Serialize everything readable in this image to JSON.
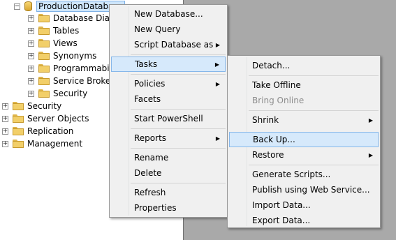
{
  "tree": {
    "root": {
      "label": "ProductionDatabase"
    },
    "children": [
      {
        "label": "Database Diagrams"
      },
      {
        "label": "Tables"
      },
      {
        "label": "Views"
      },
      {
        "label": "Synonyms"
      },
      {
        "label": "Programmability"
      },
      {
        "label": "Service Broker"
      },
      {
        "label": "Security"
      }
    ],
    "top_level": [
      {
        "label": "Security"
      },
      {
        "label": "Server Objects"
      },
      {
        "label": "Replication"
      },
      {
        "label": "Management"
      }
    ]
  },
  "context_menu": {
    "items": [
      {
        "label": "New Database..."
      },
      {
        "label": "New Query"
      },
      {
        "label": "Script Database as"
      },
      {
        "label": "Tasks"
      },
      {
        "label": "Policies"
      },
      {
        "label": "Facets"
      },
      {
        "label": "Start PowerShell"
      },
      {
        "label": "Reports"
      },
      {
        "label": "Rename"
      },
      {
        "label": "Delete"
      },
      {
        "label": "Refresh"
      },
      {
        "label": "Properties"
      }
    ]
  },
  "tasks_menu": {
    "items": [
      {
        "label": "Detach..."
      },
      {
        "label": "Take Offline"
      },
      {
        "label": "Bring Online"
      },
      {
        "label": "Shrink"
      },
      {
        "label": "Back Up..."
      },
      {
        "label": "Restore"
      },
      {
        "label": "Generate Scripts..."
      },
      {
        "label": "Publish using Web Service..."
      },
      {
        "label": "Import Data..."
      },
      {
        "label": "Export Data..."
      }
    ]
  },
  "colors": {
    "highlight": "#d6e9fb",
    "highlight_border": "#86b7ea",
    "menu_bg": "#f0f0f0"
  },
  "icons": {
    "expander_plus": "+",
    "expander_minus": "−",
    "submenu_arrow": "▶"
  }
}
